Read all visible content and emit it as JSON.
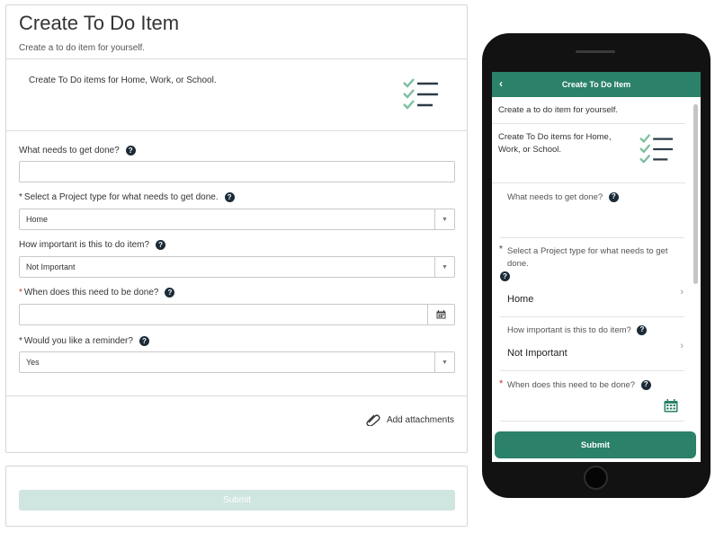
{
  "desktop": {
    "title": "Create To Do Item",
    "subtitle": "Create a to do item for yourself.",
    "description": "Create To Do items for Home, Work, or School.",
    "fields": {
      "task": {
        "label": "What needs to get done?",
        "value": "",
        "help_icon": "?"
      },
      "project": {
        "label": "Select a Project type for what needs to get done.",
        "value": "Home",
        "required_mark": "*",
        "help_icon": "?"
      },
      "importance": {
        "label": "How important is this to do item?",
        "value": "Not Important",
        "help_icon": "?"
      },
      "due": {
        "label": "When does this need to be done?",
        "value": "",
        "required_mark": "*",
        "help_icon": "?"
      },
      "reminder": {
        "label": "Would you like a reminder?",
        "value": "Yes",
        "required_mark": "*",
        "help_icon": "?"
      }
    },
    "attachments_label": "Add attachments",
    "submit_label": "Submit"
  },
  "mobile": {
    "header_title": "Create To Do Item",
    "back_icon": "‹",
    "subtitle": "Create a to do item for yourself.",
    "description": "Create To Do items for Home, Work, or School.",
    "fields": {
      "task": {
        "label": "What needs to get done?"
      },
      "project": {
        "label": "Select a Project type for what needs to get done.",
        "value": "Home",
        "required_mark": "*"
      },
      "importance": {
        "label": "How important is this to do item?",
        "value": "Not Important"
      },
      "due": {
        "label": "When does this need to be done?",
        "required_mark": "*"
      }
    },
    "chevron": "›",
    "help_icon": "?",
    "submit_label": "Submit"
  },
  "colors": {
    "brand_green": "#2b8169",
    "disabled_submit": "#cfe5e0",
    "checklist_green": "#7bbf9f",
    "required_red": "#c0392b",
    "help_icon_bg": "#1b2b38"
  },
  "icons": {
    "checklist": "checklist-icon",
    "calendar": "calendar-icon",
    "paperclip": "paperclip-icon",
    "chevron_down": "chevron-down-icon",
    "back": "back-arrow-icon"
  },
  "select_arrow": "▼"
}
